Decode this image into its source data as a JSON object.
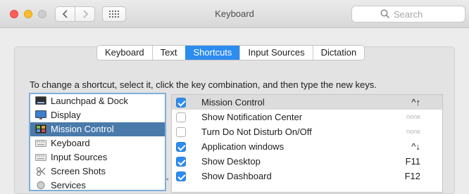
{
  "window": {
    "title": "Keyboard"
  },
  "search": {
    "placeholder": "Search"
  },
  "tabs": [
    {
      "label": "Keyboard",
      "active": false
    },
    {
      "label": "Text",
      "active": false
    },
    {
      "label": "Shortcuts",
      "active": true
    },
    {
      "label": "Input Sources",
      "active": false
    },
    {
      "label": "Dictation",
      "active": false
    }
  ],
  "instructions": "To change a shortcut, select it, click the key combination, and then type the new keys.",
  "categories": [
    {
      "label": "Launchpad & Dock",
      "icon": "launchpad-dock-icon",
      "selected": false
    },
    {
      "label": "Display",
      "icon": "display-icon",
      "selected": false
    },
    {
      "label": "Mission Control",
      "icon": "mission-control-icon",
      "selected": true
    },
    {
      "label": "Keyboard",
      "icon": "keyboard-icon",
      "selected": false
    },
    {
      "label": "Input Sources",
      "icon": "input-sources-icon",
      "selected": false
    },
    {
      "label": "Screen Shots",
      "icon": "screenshot-icon",
      "selected": false
    },
    {
      "label": "Services",
      "icon": "services-icon",
      "selected": false
    }
  ],
  "shortcuts": [
    {
      "name": "Mission Control",
      "checked": true,
      "key": "^↑",
      "highlighted": true
    },
    {
      "name": "Show Notification Center",
      "checked": false,
      "key": "none",
      "highlighted": false
    },
    {
      "name": "Turn Do Not Disturb On/Off",
      "checked": false,
      "key": "none",
      "highlighted": false
    },
    {
      "name": "Application windows",
      "checked": true,
      "key": "^↓",
      "highlighted": false
    },
    {
      "name": "Show Desktop",
      "checked": true,
      "key": "F11",
      "highlighted": false
    },
    {
      "name": "Show Dashboard",
      "checked": true,
      "key": "F12",
      "highlighted": false
    }
  ],
  "colors": {
    "accent": "#2d8cf0",
    "selection": "#4a7aaa"
  }
}
